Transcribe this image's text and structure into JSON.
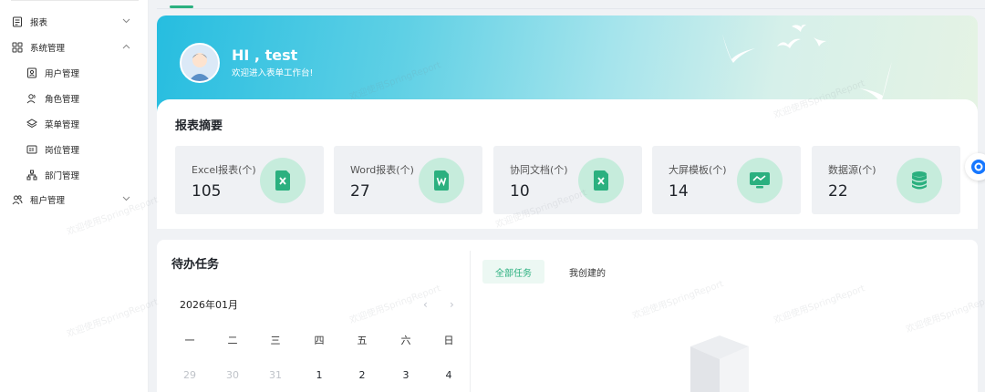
{
  "sidebar": {
    "items": [
      {
        "label": "报表",
        "icon": "report-icon",
        "chevron": "down"
      },
      {
        "label": "系统管理",
        "icon": "grid-icon",
        "chevron": "up"
      },
      {
        "label": "用户管理",
        "icon": "user-card-icon"
      },
      {
        "label": "角色管理",
        "icon": "users-icon"
      },
      {
        "label": "菜单管理",
        "icon": "layers-icon"
      },
      {
        "label": "岗位管理",
        "icon": "id-card-icon"
      },
      {
        "label": "部门管理",
        "icon": "org-chart-icon"
      },
      {
        "label": "租户管理",
        "icon": "team-icon",
        "chevron": "down"
      }
    ]
  },
  "banner": {
    "greeting": "HI , test",
    "welcome": "欢迎进入表单工作台!"
  },
  "summary": {
    "title": "报表摘要",
    "cards": [
      {
        "label": "Excel报表(个)",
        "value": "105",
        "icon": "excel-icon"
      },
      {
        "label": "Word报表(个)",
        "value": "27",
        "icon": "word-icon"
      },
      {
        "label": "协同文档(个)",
        "value": "10",
        "icon": "doc-icon"
      },
      {
        "label": "大屏模板(个)",
        "value": "14",
        "icon": "screen-icon"
      },
      {
        "label": "数据源(个)",
        "value": "22",
        "icon": "database-icon"
      }
    ]
  },
  "todo": {
    "title": "待办任务",
    "month": "2026年01月",
    "prev_arrow": "‹",
    "next_arrow": "›",
    "weekdays": [
      "一",
      "二",
      "三",
      "四",
      "五",
      "六",
      "日"
    ],
    "first_week": [
      {
        "day": "29",
        "type": "prev"
      },
      {
        "day": "30",
        "type": "prev"
      },
      {
        "day": "31",
        "type": "prev"
      },
      {
        "day": "1",
        "type": "cur"
      },
      {
        "day": "2",
        "type": "cur"
      },
      {
        "day": "3",
        "type": "cur"
      },
      {
        "day": "4",
        "type": "cur"
      }
    ],
    "tabs": {
      "all": "全部任务",
      "mine": "我创建的"
    }
  },
  "watermark": "欢迎使用SpringReport",
  "colors": {
    "accent": "#2bb07f",
    "icon_bg": "#c6ecdc",
    "card_bg": "#eff1f4"
  }
}
